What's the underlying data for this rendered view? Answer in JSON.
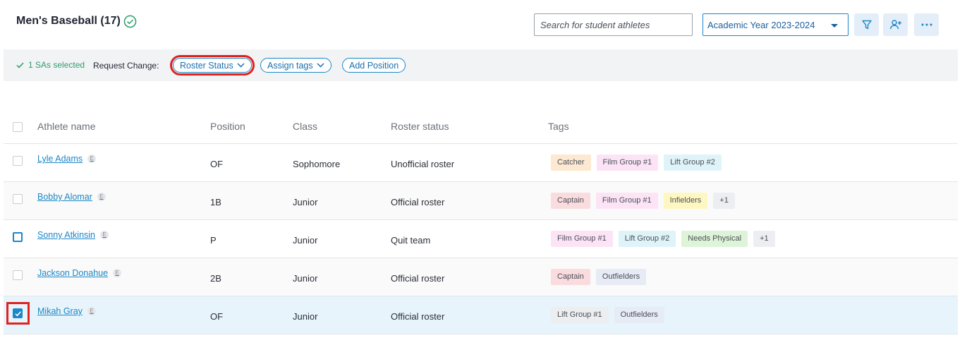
{
  "header": {
    "team_title": "Men's Baseball (17)",
    "search_placeholder": "Search for student athletes",
    "year_selected": "Academic Year 2023-2024",
    "filter_icon": "filter-icon",
    "add_user_icon": "add-user-icon",
    "more_icon": "more-horizontal-icon"
  },
  "selection": {
    "count_label": "1 SAs selected",
    "request_label": "Request Change:",
    "roster_status_label": "Roster Status",
    "assign_tags_label": "Assign tags",
    "add_position_label": "Add Position"
  },
  "table": {
    "columns": {
      "name": "Athlete name",
      "position": "Position",
      "class": "Class",
      "roster": "Roster status",
      "tags": "Tags"
    },
    "rows": [
      {
        "name": "Lyle Adams",
        "badge": "E",
        "position": "OF",
        "class": "Sophomore",
        "roster": "Unofficial roster",
        "tags": [
          "Catcher",
          "Film Group #1",
          "Lift Group #2"
        ]
      },
      {
        "name": "Bobby Alomar",
        "badge": "E",
        "position": "1B",
        "class": "Junior",
        "roster": "Official roster",
        "tags": [
          "Captain",
          "Film Group #1",
          "Infielders",
          "+1"
        ]
      },
      {
        "name": "Sonny Atkinsin",
        "badge": "E",
        "position": "P",
        "class": "Junior",
        "roster": "Quit team",
        "tags": [
          "Film Group #1",
          "Lift Group #2",
          "Needs Physical",
          "+1"
        ]
      },
      {
        "name": "Jackson Donahue",
        "badge": "E",
        "position": "2B",
        "class": "Junior",
        "roster": "Official roster",
        "tags": [
          "Captain",
          "Outfielders"
        ]
      },
      {
        "name": "Mikah Gray",
        "badge": "E",
        "position": "OF",
        "class": "Junior",
        "roster": "Official roster",
        "tags": [
          "Lift Group #1",
          "Outfielders"
        ]
      }
    ]
  },
  "colors": {
    "accent": "#1a87c8",
    "selected_row": "#e7f4fb",
    "highlight": "#e0231f",
    "tag_catcher": "#fde9d2",
    "tag_film": "#fce4f6",
    "tag_lift2": "#dff4f8",
    "tag_captain": "#fadcdf",
    "tag_infielders": "#fff7c2",
    "tag_more": "#eceef1",
    "tag_physical": "#def4d9",
    "tag_outfielders": "#e6ebf5",
    "tag_lift1": "#eceef0"
  }
}
